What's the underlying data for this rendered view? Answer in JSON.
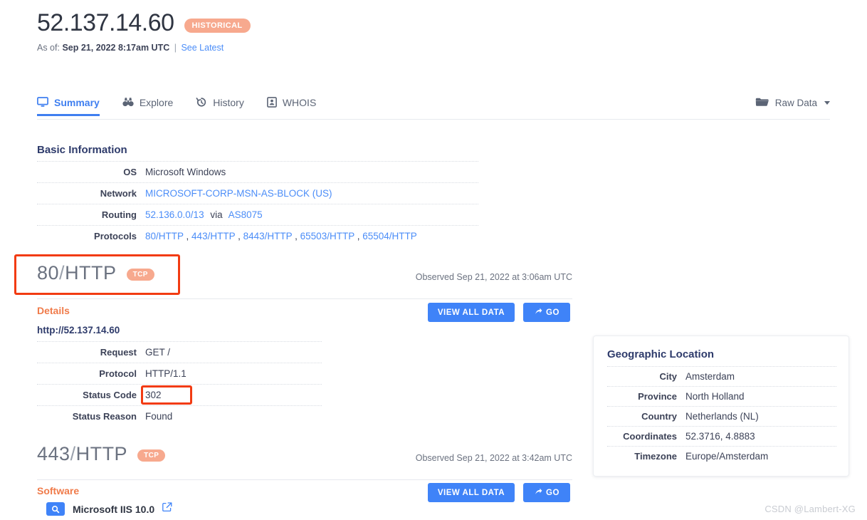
{
  "header": {
    "ip": "52.137.14.60",
    "badge": "HISTORICAL",
    "asof_label": "As of:",
    "asof_value": "Sep 21, 2022 8:17am UTC",
    "separator": "|",
    "see_latest": "See Latest"
  },
  "tabs": [
    {
      "label": "Summary",
      "icon": "monitor-icon",
      "active": true
    },
    {
      "label": "Explore",
      "icon": "binoculars-icon",
      "active": false
    },
    {
      "label": "History",
      "icon": "history-clock-icon",
      "active": false
    },
    {
      "label": "WHOIS",
      "icon": "id-card-icon",
      "active": false
    }
  ],
  "raw_data": {
    "label": "Raw Data",
    "icon": "folder-icon"
  },
  "basic_information": {
    "title": "Basic Information",
    "rows": [
      {
        "key": "OS",
        "value": "Microsoft Windows"
      },
      {
        "key": "Network",
        "value": "MICROSOFT-CORP-MSN-AS-BLOCK (US)"
      },
      {
        "key": "Routing",
        "value": "52.136.0.0/13",
        "via": "via",
        "value2": "AS8075"
      },
      {
        "key": "Protocols",
        "value": "80/HTTP , 443/HTTP , 8443/HTTP , 65503/HTTP , 65504/HTTP"
      }
    ],
    "protocols": [
      "80/HTTP",
      "443/HTTP",
      "8443/HTTP",
      "65503/HTTP",
      "65504/HTTP"
    ]
  },
  "port80": {
    "port": "80",
    "slash": "/",
    "proto": "HTTP",
    "badge": "TCP",
    "observed": "Observed Sep 21, 2022 at 3:06am UTC",
    "details_title": "Details",
    "url": "http://52.137.14.60",
    "view_all_data": "VIEW ALL DATA",
    "go": "GO",
    "rows": [
      {
        "key": "Request",
        "value": "GET /"
      },
      {
        "key": "Protocol",
        "value": "HTTP/1.1"
      },
      {
        "key": "Status Code",
        "value": "302"
      },
      {
        "key": "Status Reason",
        "value": "Found"
      }
    ]
  },
  "port443": {
    "port": "443",
    "slash": "/",
    "proto": "HTTP",
    "badge": "TCP",
    "observed": "Observed Sep 21, 2022 at 3:42am UTC",
    "software_title": "Software",
    "software_name": "Microsoft IIS 10.0",
    "software_icon": "magnifier-icon",
    "external_link_icon": "external-link-icon",
    "view_all_data": "VIEW ALL DATA",
    "go": "GO"
  },
  "geographic_location": {
    "title": "Geographic Location",
    "rows": [
      {
        "key": "City",
        "value": "Amsterdam"
      },
      {
        "key": "Province",
        "value": "North Holland"
      },
      {
        "key": "Country",
        "value": "Netherlands (NL)"
      },
      {
        "key": "Coordinates",
        "value": "52.3716, 4.8883"
      },
      {
        "key": "Timezone",
        "value": "Europe/Amsterdam"
      }
    ]
  },
  "annotations": [
    {
      "name": "port-80-highlight"
    },
    {
      "name": "status-code-highlight"
    }
  ],
  "watermark": "CSDN @Lambert-XG",
  "colors": {
    "accent_blue": "#3f83f8",
    "link_blue": "#4b8df8",
    "badge_salmon": "#f7a98e",
    "orange_heading": "#f07b4a",
    "navy": "#2e3b6b",
    "annotation_red": "#f23b12"
  }
}
